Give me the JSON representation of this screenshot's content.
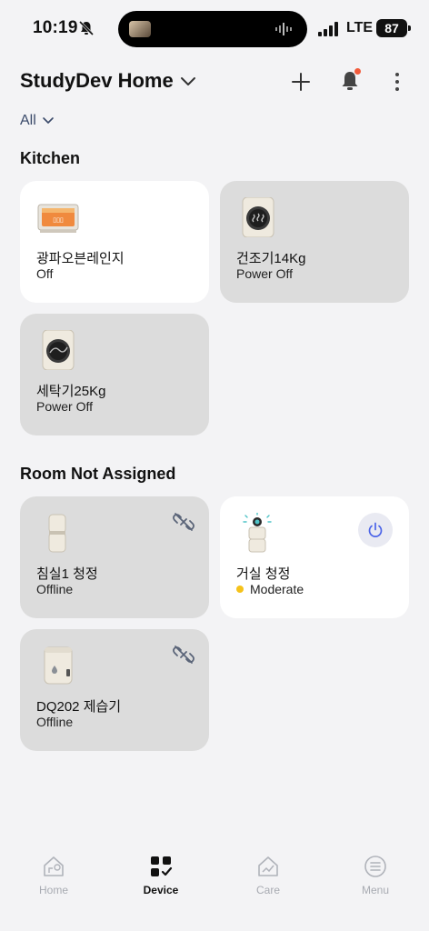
{
  "status_bar": {
    "time": "10:19",
    "network": "LTE",
    "battery": "87"
  },
  "header": {
    "home_name": "StudyDev Home",
    "filter": "All"
  },
  "sections": {
    "kitchen": {
      "title": "Kitchen",
      "devices": [
        {
          "name": "광파오븐레인지",
          "status": "Off",
          "icon": "oven-icon"
        },
        {
          "name": "건조기14Kg",
          "status": "Power Off",
          "icon": "dryer-icon"
        },
        {
          "name": "세탁기25Kg",
          "status": "Power Off",
          "icon": "washer-icon"
        }
      ]
    },
    "unassigned": {
      "title": "Room Not Assigned",
      "devices": [
        {
          "name": "침실1 청정",
          "status": "Offline",
          "icon": "air-purifier-icon"
        },
        {
          "name": "거실 청정",
          "status": "Moderate",
          "icon": "air-purifier-icon"
        },
        {
          "name": "DQ202 제습기",
          "status": "Offline",
          "icon": "dehumidifier-icon"
        }
      ]
    }
  },
  "nav": [
    {
      "label": "Home",
      "icon": "home-icon"
    },
    {
      "label": "Device",
      "icon": "device-grid-icon"
    },
    {
      "label": "Care",
      "icon": "care-icon"
    },
    {
      "label": "Menu",
      "icon": "menu-icon"
    }
  ],
  "colors": {
    "background": "#f3f3f5",
    "card_on": "#ffffff",
    "card_off": "#dcdcdc",
    "notification_dot": "#f25b3b",
    "air_quality_moderate": "#f5c21a",
    "power_button": "#4a63e8"
  }
}
